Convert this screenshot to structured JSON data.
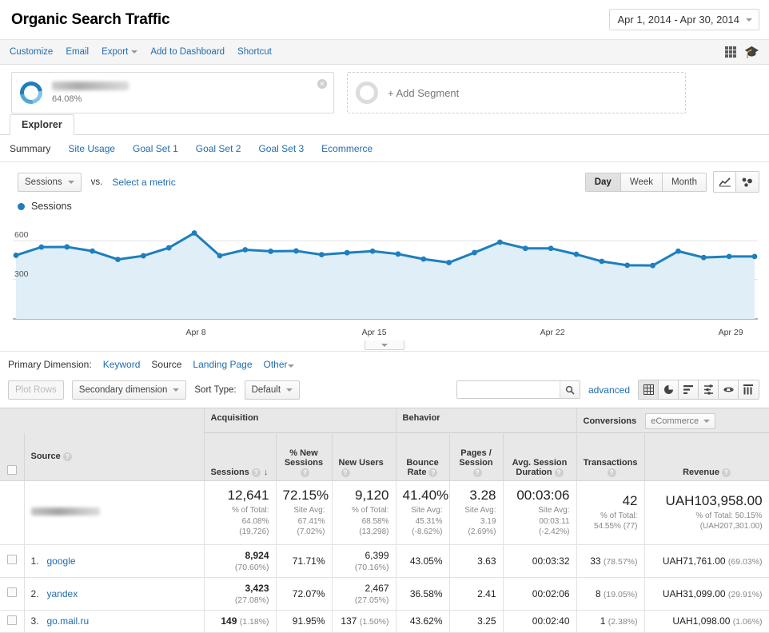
{
  "header": {
    "title": "Organic Search Traffic",
    "date_range": "Apr 1, 2014 - Apr 30, 2014"
  },
  "actionbar": {
    "items": [
      {
        "label": "Customize",
        "has_caret": false
      },
      {
        "label": "Email",
        "has_caret": false
      },
      {
        "label": "Export",
        "has_caret": true
      },
      {
        "label": "Add to Dashboard",
        "has_caret": false
      },
      {
        "label": "Shortcut",
        "has_caret": false
      }
    ]
  },
  "segments": {
    "applied": {
      "name": "",
      "percent": "64.08%"
    },
    "add_label": "+ Add Segment"
  },
  "explorer": {
    "tab_label": "Explorer",
    "subtabs": [
      {
        "label": "Summary",
        "active": true
      },
      {
        "label": "Site Usage",
        "active": false
      },
      {
        "label": "Goal Set 1",
        "active": false
      },
      {
        "label": "Goal Set 2",
        "active": false
      },
      {
        "label": "Goal Set 3",
        "active": false
      },
      {
        "label": "Ecommerce",
        "active": false
      }
    ]
  },
  "metricbar": {
    "metric": "Sessions",
    "vs": "vs.",
    "select_metric": "Select a metric",
    "granularity": [
      {
        "label": "Day",
        "active": true
      },
      {
        "label": "Week",
        "active": false
      },
      {
        "label": "Month",
        "active": false
      }
    ]
  },
  "legend": {
    "series_label": "Sessions",
    "color": "#1d7fbd"
  },
  "chart_data": {
    "type": "line",
    "title": "Sessions",
    "xlabel": "",
    "ylabel": "Sessions",
    "ylim": [
      0,
      750
    ],
    "yticks": [
      300,
      600
    ],
    "grid": true,
    "legend_position": "top-left",
    "series_color": "#1d7fbd",
    "fill_color": "#dfeef7",
    "x_tick_labels": [
      "Apr 8",
      "Apr 15",
      "Apr 22",
      "Apr 29"
    ],
    "x_tick_indices": [
      7,
      14,
      21,
      28
    ],
    "x": [
      "Apr 1",
      "Apr 2",
      "Apr 3",
      "Apr 4",
      "Apr 5",
      "Apr 6",
      "Apr 7",
      "Apr 8",
      "Apr 9",
      "Apr 10",
      "Apr 11",
      "Apr 12",
      "Apr 13",
      "Apr 14",
      "Apr 15",
      "Apr 16",
      "Apr 17",
      "Apr 18",
      "Apr 19",
      "Apr 20",
      "Apr 21",
      "Apr 22",
      "Apr 23",
      "Apr 24",
      "Apr 25",
      "Apr 26",
      "Apr 27",
      "Apr 28",
      "Apr 29",
      "Apr 30"
    ],
    "values": [
      487,
      551,
      552,
      520,
      455,
      483,
      545,
      660,
      484,
      530,
      518,
      521,
      492,
      507,
      519,
      497,
      458,
      431,
      508,
      589,
      541,
      541,
      495,
      440,
      410,
      408,
      519,
      470,
      478,
      478
    ]
  },
  "primary_dimension": {
    "label": "Primary Dimension:",
    "options": [
      {
        "label": "Keyword",
        "active": false
      },
      {
        "label": "Source",
        "active": true
      },
      {
        "label": "Landing Page",
        "active": false
      },
      {
        "label": "Other",
        "active": false,
        "has_caret": true
      }
    ]
  },
  "table_toolbar": {
    "plot_rows": "Plot Rows",
    "secondary_dimension": "Secondary dimension",
    "sort_type_label": "Sort Type:",
    "sort_type_value": "Default",
    "search_value": "",
    "search_placeholder": "",
    "advanced": "advanced"
  },
  "table": {
    "groups": [
      {
        "label": "Acquisition"
      },
      {
        "label": "Behavior"
      },
      {
        "label": "Conversions",
        "selector": "eCommerce"
      }
    ],
    "dimension_header": "Source",
    "columns": [
      "Sessions",
      "% New Sessions",
      "New Users",
      "Bounce Rate",
      "Pages / Session",
      "Avg. Session Duration",
      "Transactions",
      "Revenue"
    ],
    "totals": {
      "label": "",
      "sessions": {
        "value": "12,641",
        "line1": "% of Total:",
        "line2": "64.08%",
        "line3": "(19,726)"
      },
      "new_sessions": {
        "value": "72.15%",
        "line1": "Site Avg:",
        "line2": "67.41%",
        "line3": "(7.02%)"
      },
      "new_users": {
        "value": "9,120",
        "line1": "% of Total:",
        "line2": "68.58%",
        "line3": "(13,298)"
      },
      "bounce_rate": {
        "value": "41.40%",
        "line1": "Site Avg:",
        "line2": "45.31%",
        "line3": "(-8.62%)"
      },
      "pages_session": {
        "value": "3.28",
        "line1": "Site Avg:",
        "line2": "3.19",
        "line3": "(2.69%)"
      },
      "avg_duration": {
        "value": "00:03:06",
        "line1": "Site Avg:",
        "line2": "00:03:11",
        "line3": "(-2.42%)"
      },
      "transactions": {
        "value": "42",
        "line1": "% of Total:",
        "line2": "54.55% (77)",
        "line3": ""
      },
      "revenue": {
        "value": "UAH103,958.00",
        "line1": "% of Total: 50.15%",
        "line2": "(UAH207,301.00)",
        "line3": ""
      }
    },
    "rows": [
      {
        "index": "1.",
        "source": "google",
        "sessions": "8,924",
        "sessions_pct": "(70.60%)",
        "new_sessions": "71.71%",
        "new_users": "6,399",
        "new_users_pct": "(70.16%)",
        "bounce_rate": "43.05%",
        "pages_session": "3.63",
        "avg_duration": "00:03:32",
        "transactions": "33",
        "transactions_pct": "(78.57%)",
        "revenue": "UAH71,761.00",
        "revenue_pct": "(69.03%)"
      },
      {
        "index": "2.",
        "source": "yandex",
        "sessions": "3,423",
        "sessions_pct": "(27.08%)",
        "new_sessions": "72.07%",
        "new_users": "2,467",
        "new_users_pct": "(27.05%)",
        "bounce_rate": "36.58%",
        "pages_session": "2.41",
        "avg_duration": "00:02:06",
        "transactions": "8",
        "transactions_pct": "(19.05%)",
        "revenue": "UAH31,099.00",
        "revenue_pct": "(29.91%)"
      },
      {
        "index": "3.",
        "source": "go.mail.ru",
        "sessions": "149",
        "sessions_pct": "(1.18%)",
        "new_sessions": "91.95%",
        "new_users": "137",
        "new_users_pct": "(1.50%)",
        "bounce_rate": "43.62%",
        "pages_session": "3.25",
        "avg_duration": "00:02:40",
        "transactions": "1",
        "transactions_pct": "(2.38%)",
        "revenue": "UAH1,098.00",
        "revenue_pct": "(1.06%)"
      }
    ]
  }
}
